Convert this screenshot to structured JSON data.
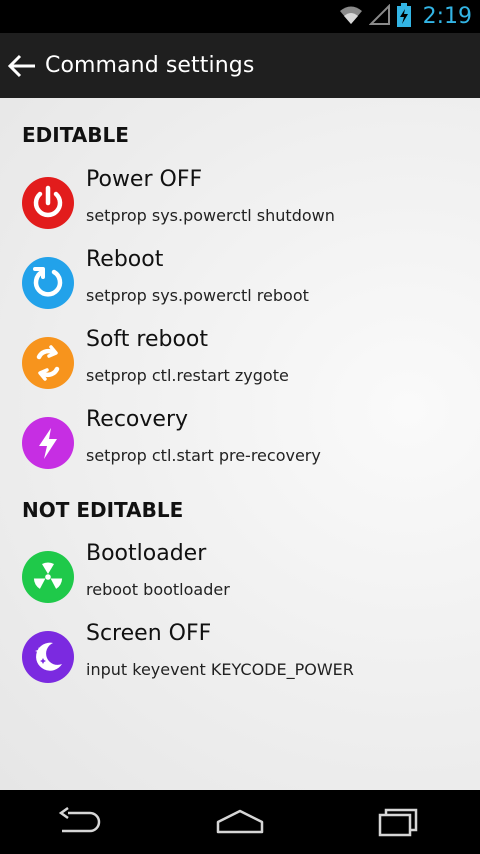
{
  "status_bar": {
    "time": "2:19",
    "icons": [
      "wifi-icon",
      "signal-icon",
      "battery-charging-icon"
    ],
    "accent_color": "#33b5e5"
  },
  "action_bar": {
    "title": "Command settings",
    "back_icon": "back-arrow-icon"
  },
  "sections": [
    {
      "header": "EDITABLE",
      "items": [
        {
          "title": "Power OFF",
          "subtitle": "setprop sys.powerctl shutdown",
          "icon": "power-icon",
          "color": "#e21c1c"
        },
        {
          "title": "Reboot",
          "subtitle": "setprop sys.powerctl reboot",
          "icon": "reboot-icon",
          "color": "#22a2ea"
        },
        {
          "title": "Soft reboot",
          "subtitle": "setprop ctl.restart zygote",
          "icon": "soft-reboot-icon",
          "color": "#f7941d"
        },
        {
          "title": "Recovery",
          "subtitle": "setprop ctl.start pre-recovery",
          "icon": "lightning-icon",
          "color": "#c62ee3"
        }
      ]
    },
    {
      "header": "NOT EDITABLE",
      "items": [
        {
          "title": "Bootloader",
          "subtitle": "reboot bootloader",
          "icon": "radiation-icon",
          "color": "#1fc94a"
        },
        {
          "title": "Screen OFF",
          "subtitle": "input keyevent KEYCODE_POWER",
          "icon": "moon-stars-icon",
          "color": "#7b2ae0"
        }
      ]
    }
  ],
  "nav_bar": {
    "buttons": [
      "back-nav-icon",
      "home-nav-icon",
      "recents-nav-icon"
    ]
  }
}
